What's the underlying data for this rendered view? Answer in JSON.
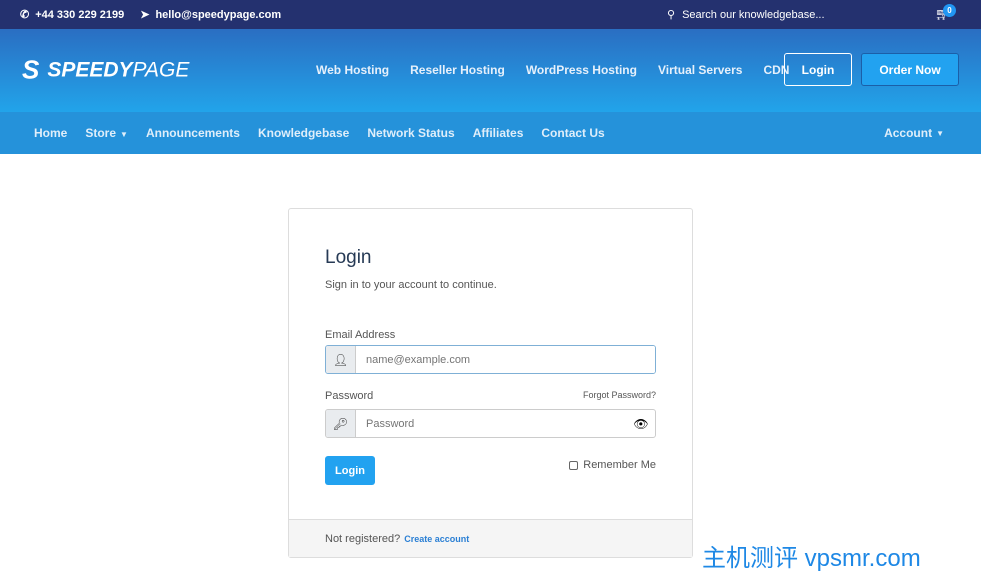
{
  "topbar": {
    "phone": "+44 330 229 2199",
    "email": "hello@speedypage.com",
    "search_placeholder": "Search our knowledgebase...",
    "cart_count": "0"
  },
  "header": {
    "logo_bold": "SPEEDY",
    "logo_light": "PAGE",
    "nav": [
      "Web Hosting",
      "Reseller Hosting",
      "WordPress Hosting",
      "Virtual Servers",
      "CDN"
    ],
    "login": "Login",
    "order": "Order Now"
  },
  "subnav": {
    "items": [
      "Home",
      "Store",
      "Announcements",
      "Knowledgebase",
      "Network Status",
      "Affiliates",
      "Contact Us"
    ],
    "account": "Account"
  },
  "login": {
    "title": "Login",
    "subtitle": "Sign in to your account to continue.",
    "email_label": "Email Address",
    "email_placeholder": "name@example.com",
    "password_label": "Password",
    "forgot": "Forgot Password?",
    "password_placeholder": "Password",
    "submit": "Login",
    "remember": "Remember Me",
    "not_registered": "Not registered?",
    "create": "Create account"
  },
  "watermark": "主机测评 vpsmr.com"
}
